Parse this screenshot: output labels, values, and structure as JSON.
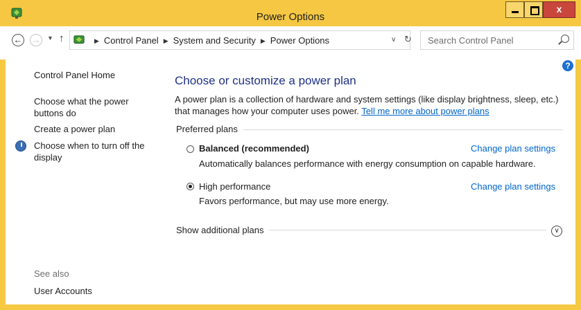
{
  "window": {
    "title": "Power Options",
    "minimize_glyph": "",
    "close_glyph": "x"
  },
  "address": {
    "crumbs": [
      "Control Panel",
      "System and Security",
      "Power Options"
    ],
    "search_placeholder": "Search Control Panel"
  },
  "sidebar": {
    "home": "Control Panel Home",
    "links": [
      "Choose what the power buttons do",
      "Create a power plan",
      "Choose when to turn off the display"
    ],
    "see_also_label": "See also",
    "see_also_links": [
      "User Accounts"
    ]
  },
  "main": {
    "title": "Choose or customize a power plan",
    "description": "A power plan is a collection of hardware and system settings (like display brightness, sleep, etc.) that manages how your computer uses power.",
    "learn_more": "Tell me more about power plans",
    "preferred_label": "Preferred plans",
    "plans": [
      {
        "name": "Balanced (recommended)",
        "description": "Automatically balances performance with energy consumption on capable hardware.",
        "link": "Change plan settings",
        "selected": false
      },
      {
        "name": "High performance",
        "description": "Favors performance, but may use more energy.",
        "link": "Change plan settings",
        "selected": true
      }
    ],
    "additional_label": "Show additional plans"
  },
  "colors": {
    "titlebar": "#f5c742",
    "link": "#0066cc",
    "heading": "#1e3287",
    "close_button": "#c9463d"
  }
}
